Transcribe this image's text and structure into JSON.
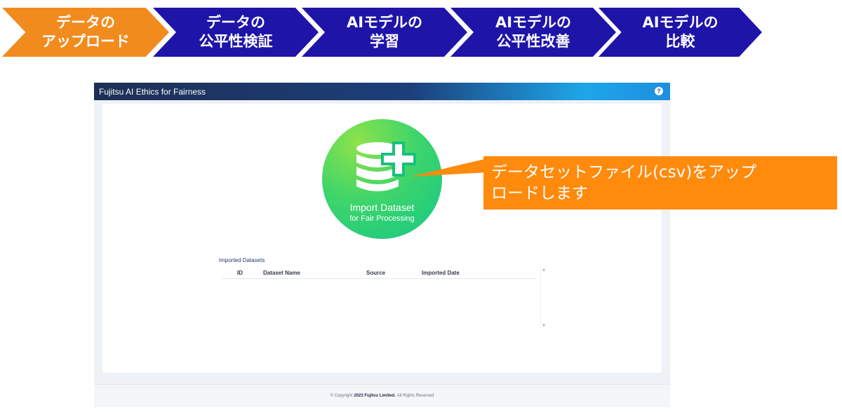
{
  "steps": [
    {
      "line1": "データの",
      "line2": "アップロード",
      "active": true
    },
    {
      "line1": "データの",
      "line2": "公平性検証",
      "active": false
    },
    {
      "line1": "AIモデルの",
      "line2": "学習",
      "active": false
    },
    {
      "line1": "AIモデルの",
      "line2": "公平性改善",
      "active": false
    },
    {
      "line1": "AIモデルの",
      "line2": "比較",
      "active": false
    }
  ],
  "app": {
    "title": "Fujitsu AI Ethics for Fairness",
    "help_label": "?"
  },
  "import": {
    "title": "Import Dataset",
    "subtitle": "for Fair Processing",
    "icon": "database-add-icon"
  },
  "datasets": {
    "section_title": "Imported Datasets",
    "columns": [
      "ID",
      "Dataset Name",
      "Source",
      "Imported Date"
    ],
    "rows": []
  },
  "footer": {
    "prefix": "© Copyright",
    "company": "2023 Fujitsu Limited.",
    "suffix": "All Rights Reserved"
  },
  "callout": {
    "line1": "データセットファイル(csv)をアップ",
    "line2": "ロードします"
  },
  "colors": {
    "step_active": "#f28b1e",
    "step_inactive": "#1f14a8",
    "callout": "#ff8a0c",
    "import_green": "#14c787"
  }
}
